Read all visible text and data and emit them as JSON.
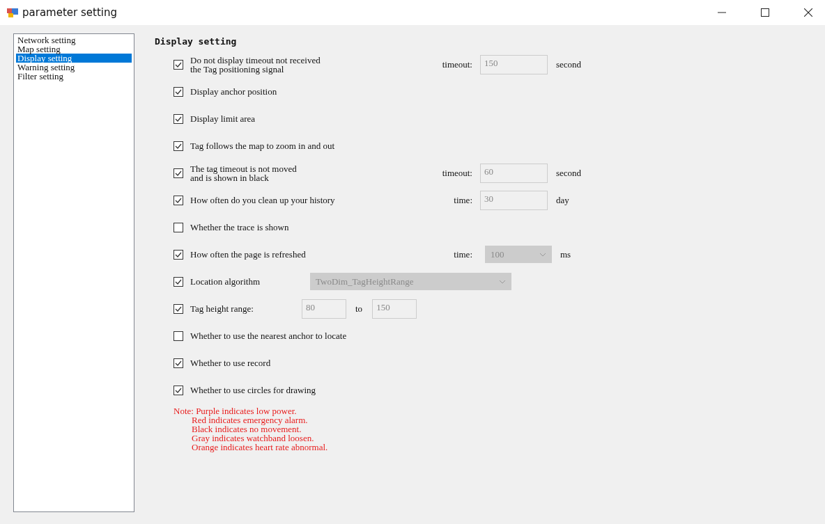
{
  "window": {
    "title": "parameter setting"
  },
  "sidebar": {
    "items": [
      {
        "label": "Network setting",
        "selected": false
      },
      {
        "label": "Map setting",
        "selected": false
      },
      {
        "label": "Display setting",
        "selected": true
      },
      {
        "label": "Warning setting",
        "selected": false
      },
      {
        "label": "Filter setting",
        "selected": false
      }
    ]
  },
  "section_title": "Display setting",
  "options": [
    {
      "kind": "field",
      "label": "Do not display timeout not received\nthe Tag positioning signal",
      "checked": true,
      "field_label": "timeout:",
      "value": "150",
      "unit": "second"
    },
    {
      "kind": "plain",
      "label": "Display anchor position",
      "checked": true
    },
    {
      "kind": "plain",
      "label": "Display limit area",
      "checked": true
    },
    {
      "kind": "plain",
      "label": "Tag follows the map to zoom in and out",
      "checked": true
    },
    {
      "kind": "field",
      "label": "The tag timeout is not moved\nand is shown in black",
      "checked": true,
      "field_label": "timeout:",
      "value": "60",
      "unit": "second"
    },
    {
      "kind": "field",
      "label": "How often do you clean up your history",
      "checked": true,
      "field_label": "time:",
      "value": "30",
      "unit": "day"
    },
    {
      "kind": "plain",
      "label": "Whether the trace is shown",
      "checked": false
    },
    {
      "kind": "dropdown",
      "label": "How often the page is refreshed",
      "checked": true,
      "field_label": "time:",
      "value": "100",
      "unit": "ms"
    },
    {
      "kind": "combo",
      "label": "Location algorithm",
      "checked": true,
      "value": "TwoDim_TagHeightRange"
    },
    {
      "kind": "range",
      "label": "Tag height range:",
      "checked": true,
      "from": "80",
      "separator": "to",
      "to": "150"
    },
    {
      "kind": "plain",
      "label": "Whether to use the nearest anchor to locate",
      "checked": false
    },
    {
      "kind": "plain",
      "label": "Whether to use record",
      "checked": true
    },
    {
      "kind": "plain",
      "label": "Whether to use circles for drawing",
      "checked": true
    }
  ],
  "note": [
    "Note: Purple indicates low power.",
    "Red indicates emergency alarm.",
    "Black indicates no movement.",
    "Gray indicates watchband loosen.",
    "Orange indicates heart rate abnormal."
  ]
}
